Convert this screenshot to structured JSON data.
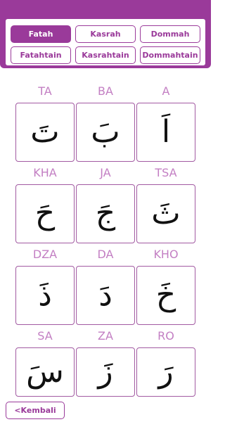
{
  "colors": {
    "accent": "#9a3a9a",
    "label": "#c37fc3",
    "card_border": "#a25aa2"
  },
  "tabs": [
    {
      "label": "Fatah",
      "active": true
    },
    {
      "label": "Kasrah",
      "active": false
    },
    {
      "label": "Dommah",
      "active": false
    },
    {
      "label": "Fatahtain",
      "active": false
    },
    {
      "label": "Kasrahtain",
      "active": false
    },
    {
      "label": "Dommahtain",
      "active": false
    }
  ],
  "letters": [
    {
      "name": "TA",
      "glyph": "تَ"
    },
    {
      "name": "BA",
      "glyph": "بَ"
    },
    {
      "name": "A",
      "glyph": "اَ"
    },
    {
      "name": "KHA",
      "glyph": "حَ"
    },
    {
      "name": "JA",
      "glyph": "جَ"
    },
    {
      "name": "TSA",
      "glyph": "ثَ"
    },
    {
      "name": "DZA",
      "glyph": "ذَ"
    },
    {
      "name": "DA",
      "glyph": "دَ"
    },
    {
      "name": "KHO",
      "glyph": "خَ"
    },
    {
      "name": "SA",
      "glyph": "سَ"
    },
    {
      "name": "ZA",
      "glyph": "زَ"
    },
    {
      "name": "RO",
      "glyph": "رَ"
    }
  ],
  "back_button": {
    "label": "<Kembali"
  }
}
